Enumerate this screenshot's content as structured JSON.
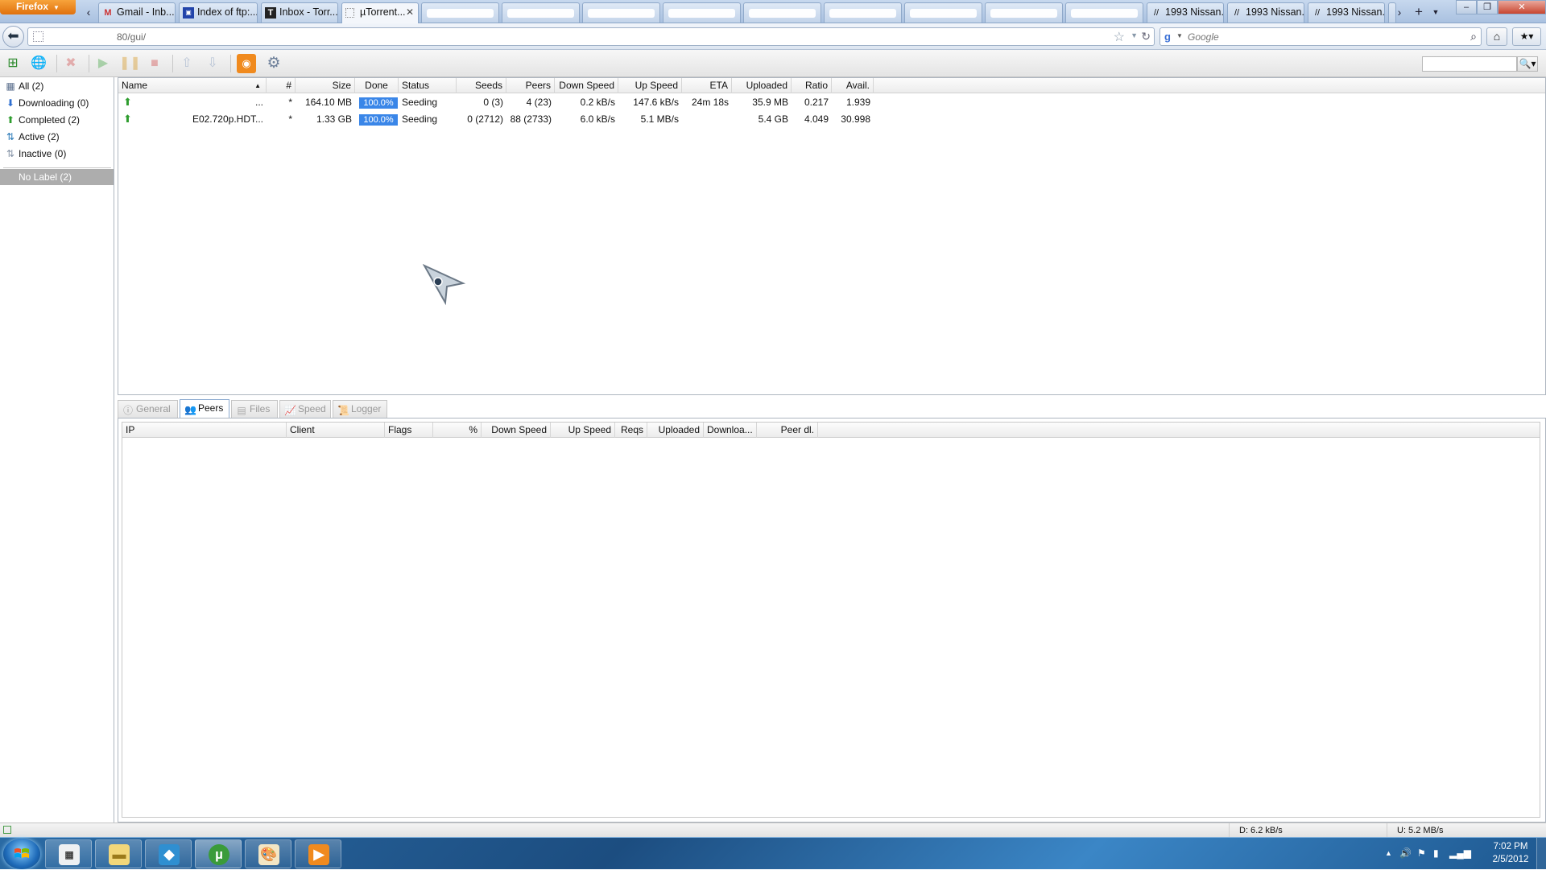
{
  "firefox": {
    "menu_label": "Firefox",
    "tabs": [
      {
        "label": "Gmail - Inb...",
        "icon": "gmail-icon"
      },
      {
        "label": "Index of ftp:...",
        "icon": "page-icon"
      },
      {
        "label": "Inbox - Torr...",
        "icon": "t-icon"
      },
      {
        "label": "µTorrent...",
        "icon": "blank-page-icon",
        "active": true
      },
      {
        "label": "1993 Nissan...",
        "icon": "slash-icon"
      },
      {
        "label": "1993 Nissan...",
        "icon": "slash-icon"
      },
      {
        "label": "1993 Nissan...",
        "icon": "slash-icon"
      }
    ],
    "url": "80/gui/",
    "search_placeholder": "Google"
  },
  "categories": [
    {
      "label": "All (2)",
      "icon": "all-icon"
    },
    {
      "label": "Downloading (0)",
      "icon": "download-arrow-icon"
    },
    {
      "label": "Completed (2)",
      "icon": "completed-icon"
    },
    {
      "label": "Active (2)",
      "icon": "active-icon"
    },
    {
      "label": "Inactive (0)",
      "icon": "inactive-icon"
    }
  ],
  "label_filter": "No Label (2)",
  "torrent_columns": [
    "Name",
    "#",
    "Size",
    "Done",
    "Status",
    "Seeds",
    "Peers",
    "Down Speed",
    "Up Speed",
    "ETA",
    "Uploaded",
    "Ratio",
    "Avail."
  ],
  "torrents": [
    {
      "name": "...",
      "queue": "*",
      "size": "164.10 MB",
      "done": "100.0%",
      "done_fraction": 1.0,
      "status": "Seeding",
      "seeds": "0 (3)",
      "peers": "4 (23)",
      "down_speed": "0.2 kB/s",
      "up_speed": "147.6 kB/s",
      "eta": "24m 18s",
      "uploaded": "35.9 MB",
      "ratio": "0.217",
      "avail": "1.939"
    },
    {
      "name": "E02.720p.HDT...",
      "queue": "*",
      "size": "1.33 GB",
      "done": "100.0%",
      "done_fraction": 1.0,
      "status": "Seeding",
      "seeds": "0 (2712)",
      "peers": "88 (2733)",
      "down_speed": "6.0 kB/s",
      "up_speed": "5.1 MB/s",
      "eta": "",
      "uploaded": "5.4 GB",
      "ratio": "4.049",
      "avail": "30.998"
    }
  ],
  "detail_tabs": [
    "General",
    "Peers",
    "Files",
    "Speed",
    "Logger"
  ],
  "active_detail_tab": "Peers",
  "peer_columns": [
    "IP",
    "Client",
    "Flags",
    "%",
    "Down Speed",
    "Up Speed",
    "Reqs",
    "Uploaded",
    "Downloa...",
    "Peer dl."
  ],
  "status": {
    "down": "D: 6.2 kB/s",
    "up": "U: 5.2 MB/s"
  },
  "clock": {
    "time": "7:02 PM",
    "date": "2/5/2012"
  }
}
